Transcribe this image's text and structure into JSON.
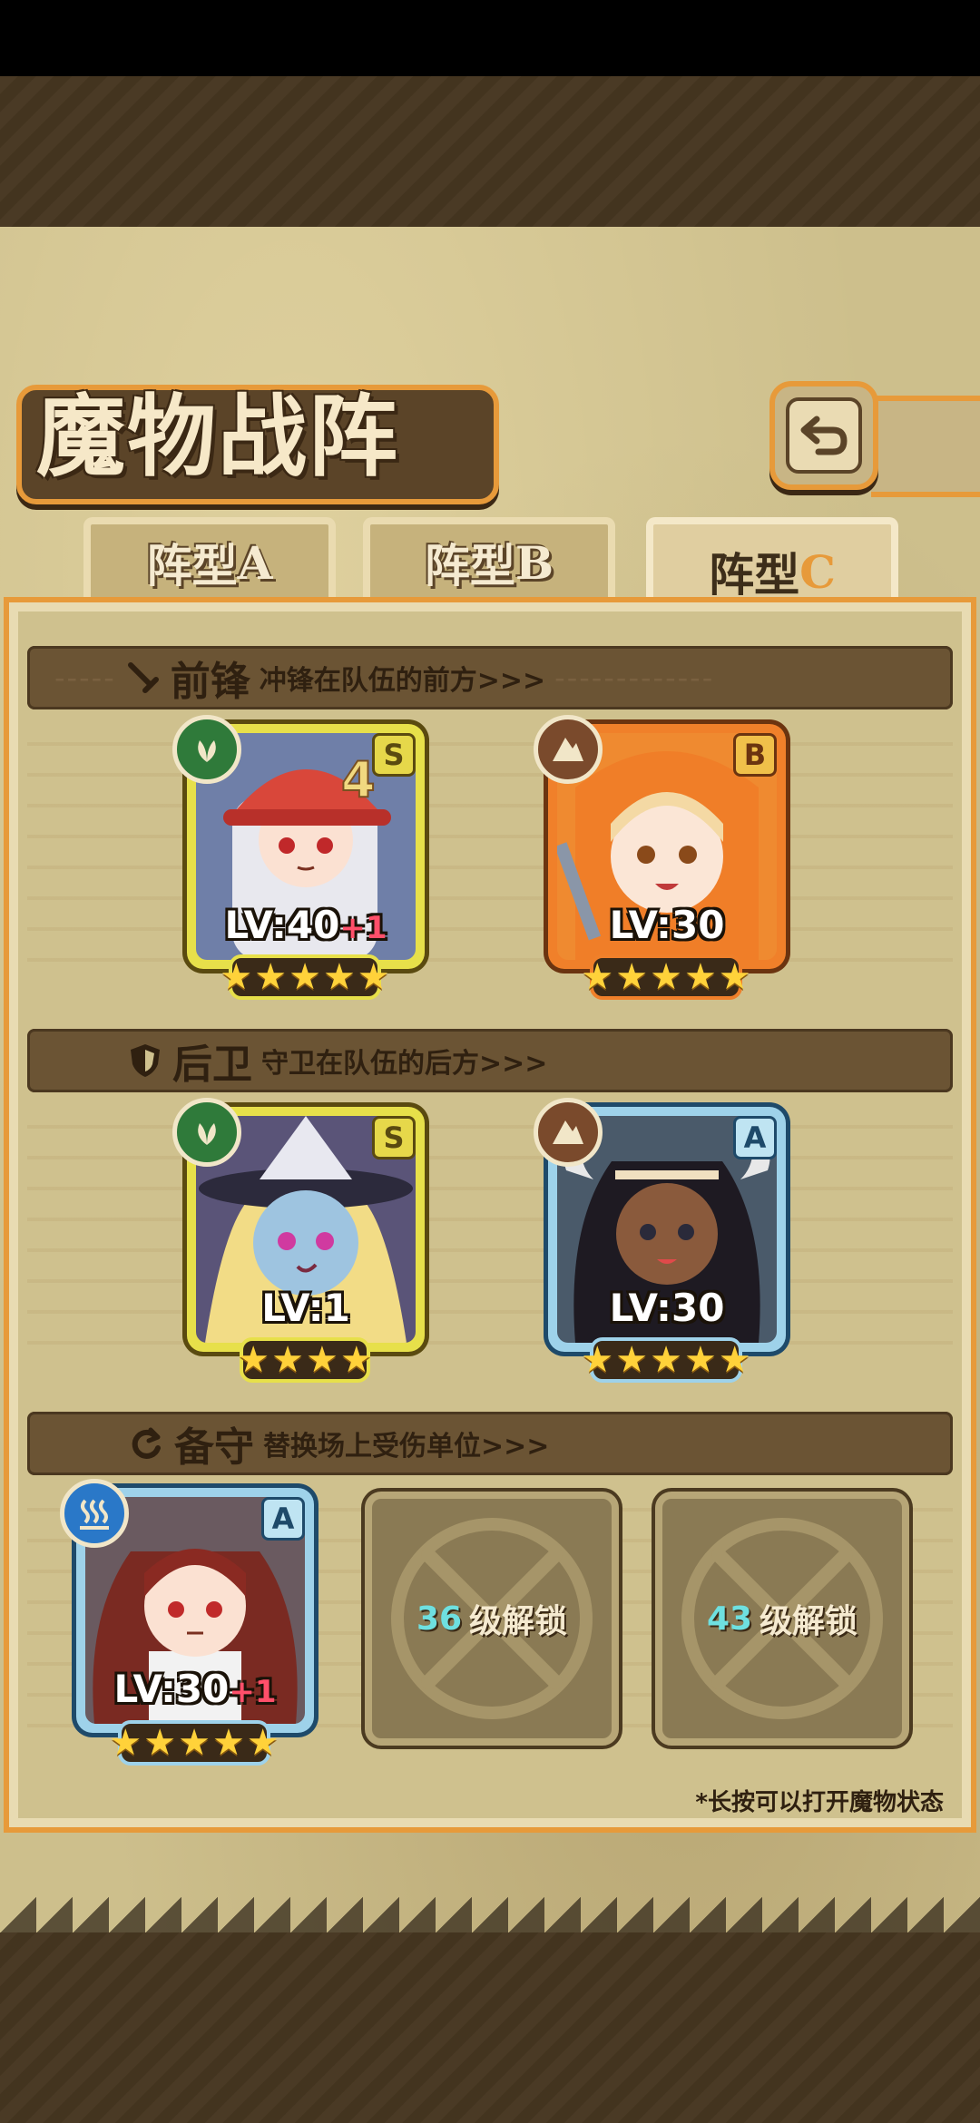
{
  "title": "魔物战阵",
  "tabs": [
    {
      "label": "阵型",
      "letter": "A",
      "active": false
    },
    {
      "label": "阵型",
      "letter": "B",
      "active": false
    },
    {
      "label": "阵型",
      "letter": "C",
      "active": true
    }
  ],
  "sections": {
    "front": {
      "title": "前锋",
      "desc": "冲锋在队伍的前方>>>",
      "icon": "sword-icon"
    },
    "rear": {
      "title": "后卫",
      "desc": "守卫在队伍的后方>>>",
      "icon": "shield-icon"
    },
    "reserve": {
      "title": "备守",
      "desc": "替换场上受伤单位>>>",
      "icon": "swap-icon"
    }
  },
  "units": [
    {
      "slot": "front-1",
      "element": "leaf-icon",
      "rank": "S",
      "level": "LV:40",
      "bonus": "+1",
      "stars": 5,
      "frame": "#e7e04a"
    },
    {
      "slot": "front-2",
      "element": "rock-icon",
      "rank": "B",
      "level": "LV:30",
      "bonus": "",
      "stars": 5,
      "frame": "#f0802a"
    },
    {
      "slot": "rear-1",
      "element": "leaf-icon",
      "rank": "S",
      "level": "LV:1",
      "bonus": "",
      "stars": 4,
      "frame": "#e7e04a"
    },
    {
      "slot": "rear-2",
      "element": "rock-icon",
      "rank": "A",
      "level": "LV:30",
      "bonus": "",
      "stars": 5,
      "frame": "#9ed2ea"
    },
    {
      "slot": "reserve-1",
      "element": "water-icon",
      "rank": "A",
      "level": "LV:30",
      "bonus": "+1",
      "stars": 5,
      "frame": "#9ed2ea"
    }
  ],
  "locked_slots": [
    {
      "level": "36",
      "text": "级解锁"
    },
    {
      "level": "43",
      "text": "级解锁"
    }
  ],
  "hint": "*长按可以打开魔物状态",
  "colors": {
    "accent": "#e79a3a",
    "parchment": "#cfc18e",
    "star": "#ffd23a"
  }
}
